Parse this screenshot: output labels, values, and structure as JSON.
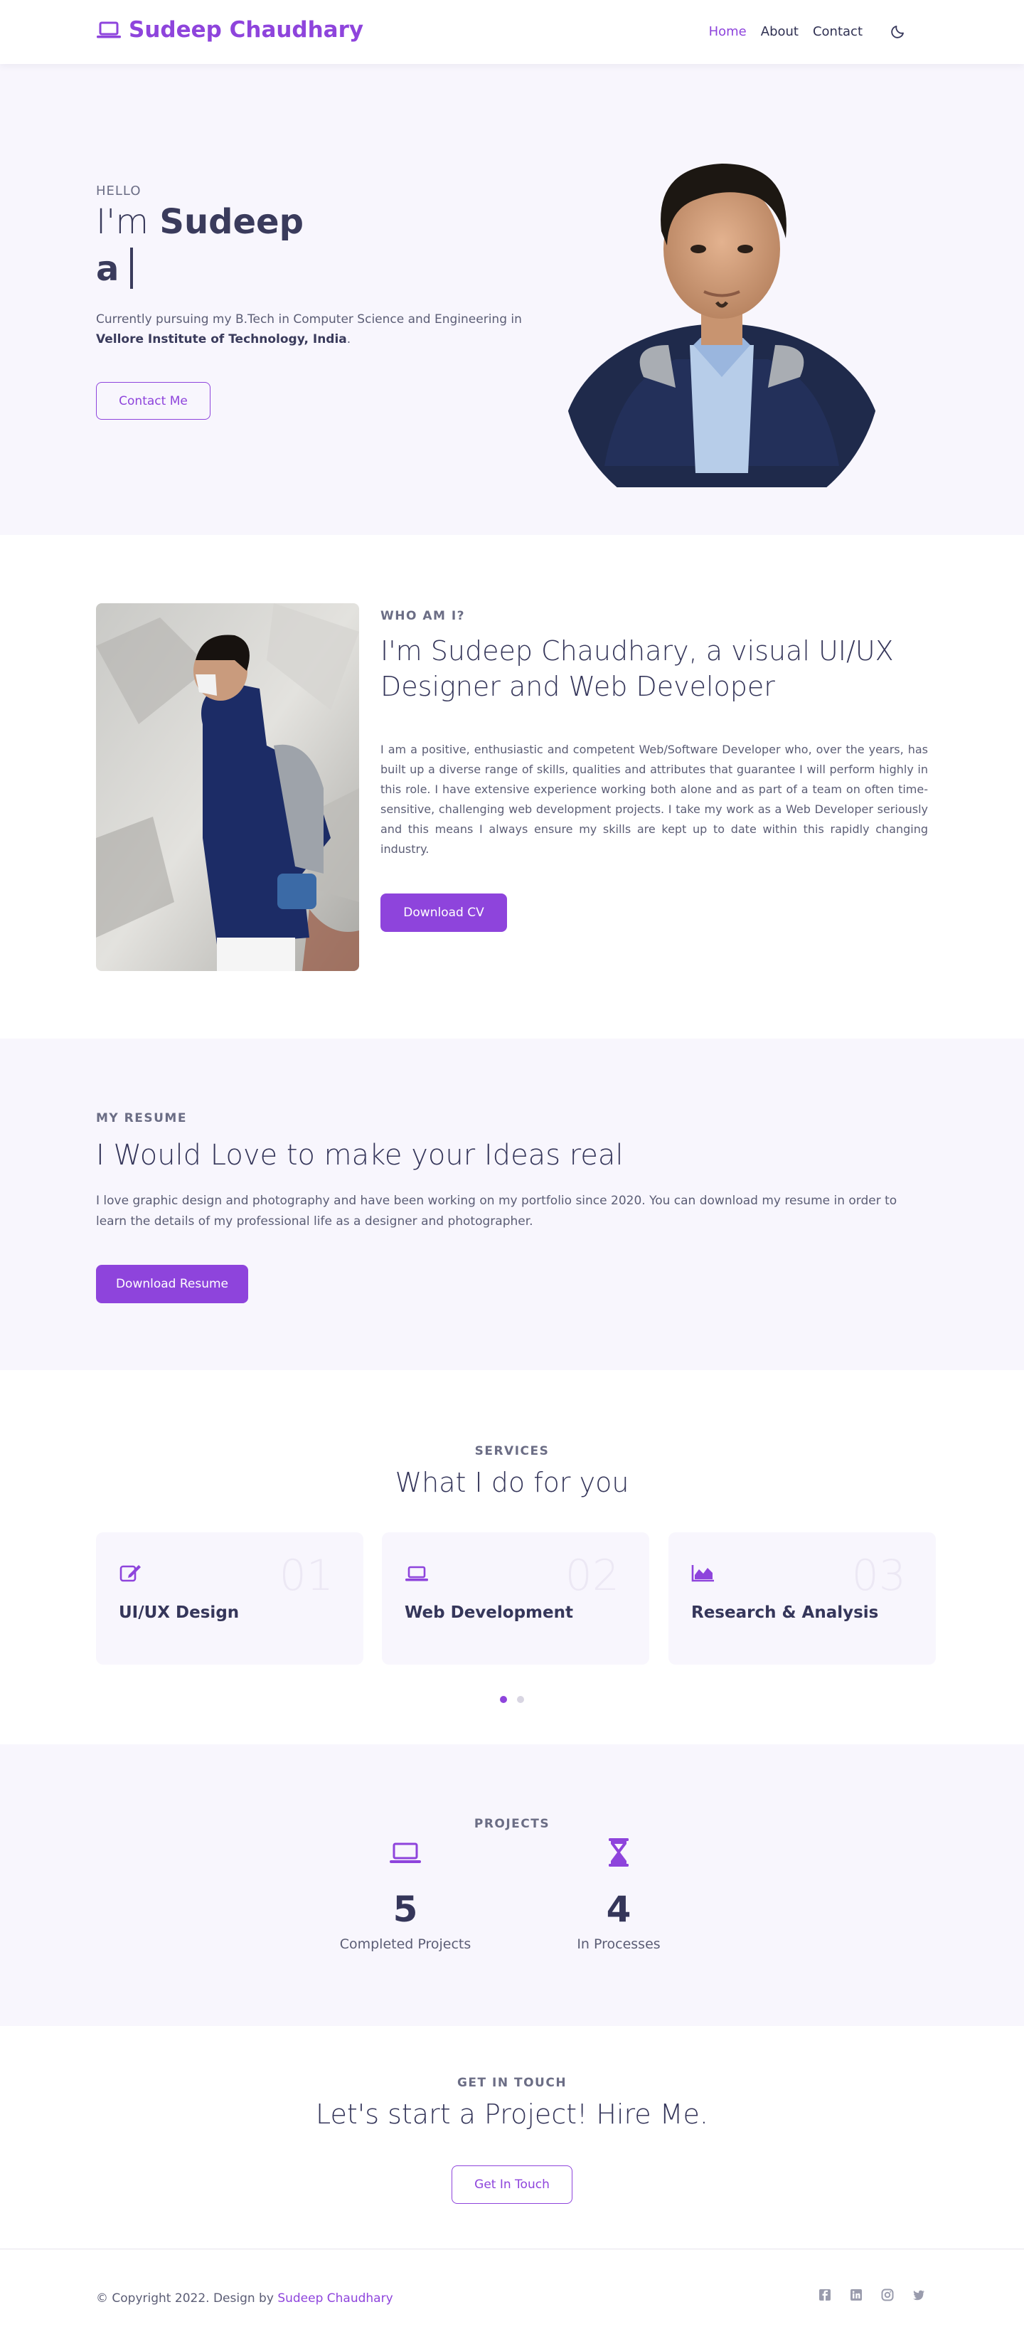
{
  "colors": {
    "accent": "#8e44dc",
    "text": "#35365a",
    "muted": "#5b5d75",
    "section_bg": "#f8f6fd"
  },
  "nav": {
    "brand": "Sudeep Chaudhary",
    "brand_icon": "laptop-icon",
    "links": [
      "Home",
      "About",
      "Contact"
    ],
    "active": "Home",
    "theme_icon": "moon-icon"
  },
  "hero": {
    "greeting": "HELLO",
    "title_prefix": "I'm",
    "title_name": "Sudeep",
    "typed_text": "a",
    "description_prefix": "Currently pursuing my B.Tech in Computer Science and Engineering in",
    "school": "Vellore Institute of Technology, India",
    "description_suffix": ".",
    "cta": "Contact Me"
  },
  "about": {
    "eyebrow": "WHO AM I?",
    "title": "I'm Sudeep Chaudhary, a visual UI/UX Designer and Web Developer",
    "text": "I am a positive, enthusiastic and competent Web/Software Developer who, over the years, has built up a diverse range of skills, qualities and attributes that guarantee I will perform highly in this role. I have extensive experience working both alone and as part of a team on often time-sensitive, challenging web development projects. I take my work as a Web Developer seriously and this means I always ensure my skills are kept up to date within this rapidly changing industry.",
    "cta": "Download CV"
  },
  "resume": {
    "eyebrow": "MY RESUME",
    "title": "I Would Love to make your Ideas real",
    "text": "I love graphic design and photography and have been working on my portfolio since 2020. You can download my resume in order to learn the details of my professional life as a designer and photographer.",
    "cta": "Download Resume"
  },
  "services": {
    "eyebrow": "SERVICES",
    "title": "What I do for you",
    "items": [
      {
        "num": "01",
        "title": "UI/UX Design",
        "icon": "edit-icon"
      },
      {
        "num": "02",
        "title": "Web Development",
        "icon": "laptop-icon"
      },
      {
        "num": "03",
        "title": "Research & Analysis",
        "icon": "area-chart-icon"
      }
    ],
    "active_slide": 1,
    "slide_count": 2
  },
  "projects": {
    "eyebrow": "PROJECTS",
    "items": [
      {
        "value": "5",
        "label": "Completed Projects",
        "icon": "laptop-icon"
      },
      {
        "value": "4",
        "label": "In Processes",
        "icon": "hourglass-icon"
      }
    ]
  },
  "contact": {
    "eyebrow": "GET IN TOUCH",
    "title": "Let's start a Project! Hire Me.",
    "cta": "Get In Touch"
  },
  "footer": {
    "copyright": "© Copyright 2022. Design by",
    "author": "Sudeep Chaudhary",
    "social_icons": [
      "facebook-icon",
      "linkedin-icon",
      "instagram-icon",
      "twitter-icon"
    ]
  }
}
